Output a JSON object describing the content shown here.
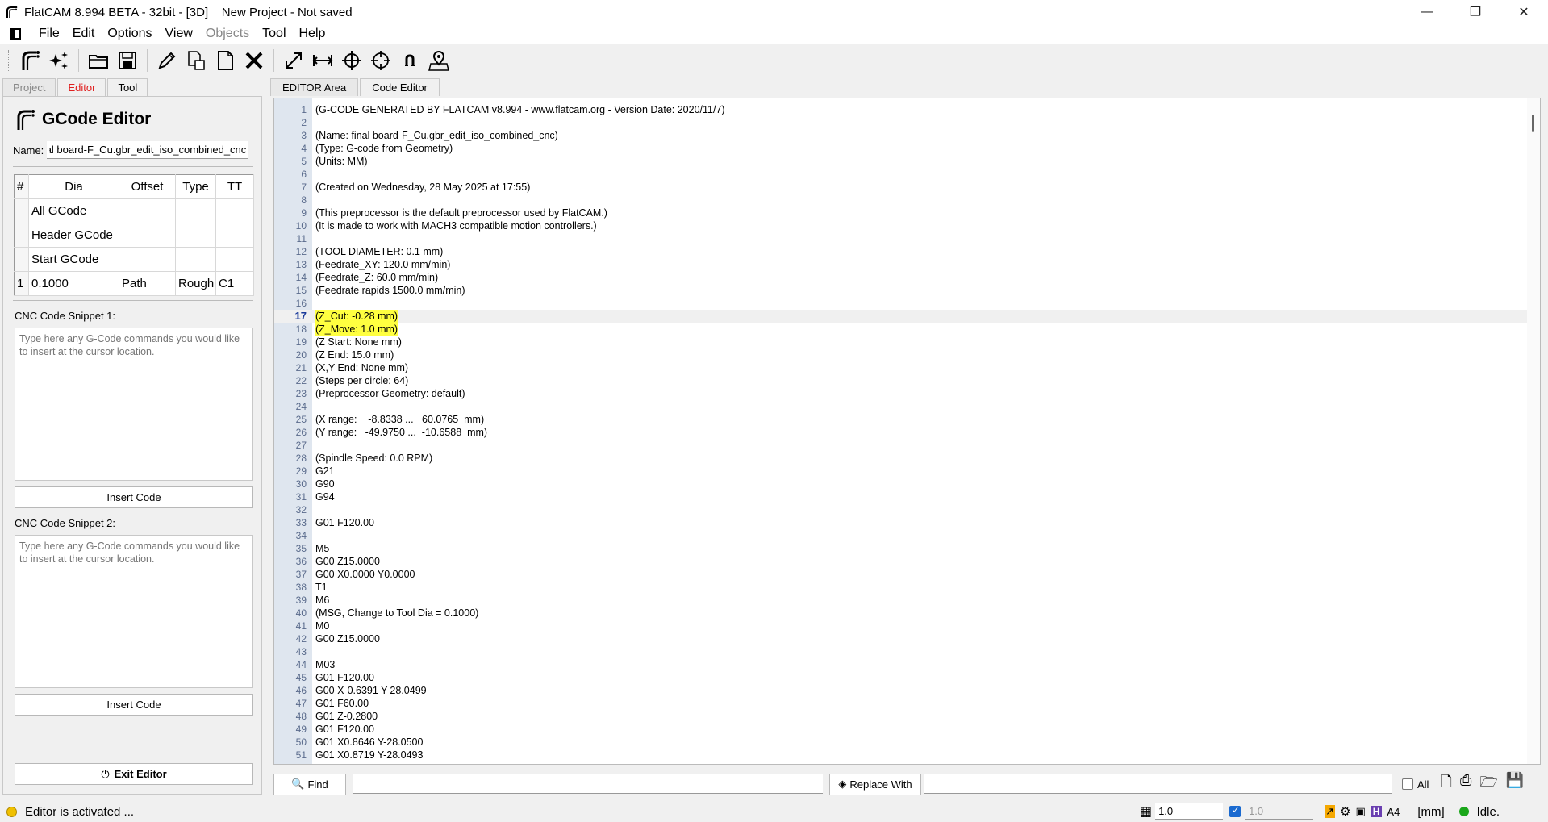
{
  "window": {
    "title": "FlatCAM 8.994 BETA - 32bit - [3D]    New Project - Not saved",
    "minimize": "—",
    "maximize": "❐",
    "close": "✕"
  },
  "menu": [
    "File",
    "Edit",
    "Options",
    "View",
    "Objects",
    "Tool",
    "Help"
  ],
  "left_tabs": [
    "Project",
    "Editor",
    "Tool"
  ],
  "editor": {
    "title": "GCode Editor",
    "name_label": "Name:",
    "name_value": "final board-F_Cu.gbr_edit_iso_combined_cnc",
    "table": {
      "headers": [
        "#",
        "Dia",
        "Offset",
        "Type",
        "TT"
      ],
      "rows": [
        [
          "",
          "All GCode",
          "",
          "",
          ""
        ],
        [
          "",
          "Header GCode",
          "",
          "",
          ""
        ],
        [
          "",
          "Start GCode",
          "",
          "",
          ""
        ],
        [
          "1",
          "0.1000",
          "Path",
          "Rough",
          "C1"
        ]
      ]
    },
    "snippet1_label": "CNC Code Snippet 1:",
    "snippet2_label": "CNC Code Snippet 2:",
    "snippet_placeholder": "Type here any G-Code commands you would like to insert at the cursor location.",
    "insert_code": "Insert Code",
    "exit_editor": "Exit Editor"
  },
  "right_tabs": [
    "EDITOR Area",
    "Code Editor"
  ],
  "code_lines": [
    "(G-CODE GENERATED BY FLATCAM v8.994 - www.flatcam.org - Version Date: 2020/11/7)",
    "",
    "(Name: final board-F_Cu.gbr_edit_iso_combined_cnc)",
    "(Type: G-code from Geometry)",
    "(Units: MM)",
    "",
    "(Created on Wednesday, 28 May 2025 at 17:55)",
    "",
    "(This preprocessor is the default preprocessor used by FlatCAM.)",
    "(It is made to work with MACH3 compatible motion controllers.)",
    "",
    "(TOOL DIAMETER: 0.1 mm)",
    "(Feedrate_XY: 120.0 mm/min)",
    "(Feedrate_Z: 60.0 mm/min)",
    "(Feedrate rapids 1500.0 mm/min)",
    "",
    "(Z_Cut: -0.28 mm)",
    "(Z_Move: 1.0 mm)",
    "(Z Start: None mm)",
    "(Z End: 15.0 mm)",
    "(X,Y End: None mm)",
    "(Steps per circle: 64)",
    "(Preprocessor Geometry: default)",
    "",
    "(X range:    -8.8338 ...   60.0765  mm)",
    "(Y range:   -49.9750 ...  -10.6588  mm)",
    "",
    "(Spindle Speed: 0.0 RPM)",
    "G21",
    "G90",
    "G94",
    "",
    "G01 F120.00",
    "",
    "M5",
    "G00 Z15.0000",
    "G00 X0.0000 Y0.0000",
    "T1",
    "M6",
    "(MSG, Change to Tool Dia = 0.1000)",
    "M0",
    "G00 Z15.0000",
    "",
    "M03",
    "G01 F120.00",
    "G00 X-0.6391 Y-28.0499",
    "G01 F60.00",
    "G01 Z-0.2800",
    "G01 F120.00",
    "G01 X0.8646 Y-28.0500",
    "G01 X0.8719 Y-28.0493"
  ],
  "current_line": 17,
  "highlighted_lines": [
    17,
    18
  ],
  "find_bar": {
    "find": "Find",
    "replace_with": "Replace With",
    "all_label": "All"
  },
  "status": {
    "message": "Editor is activated ...",
    "grid_x": "1.0",
    "grid_y": "1.0",
    "page": "A4",
    "units": "[mm]",
    "state": "Idle."
  }
}
